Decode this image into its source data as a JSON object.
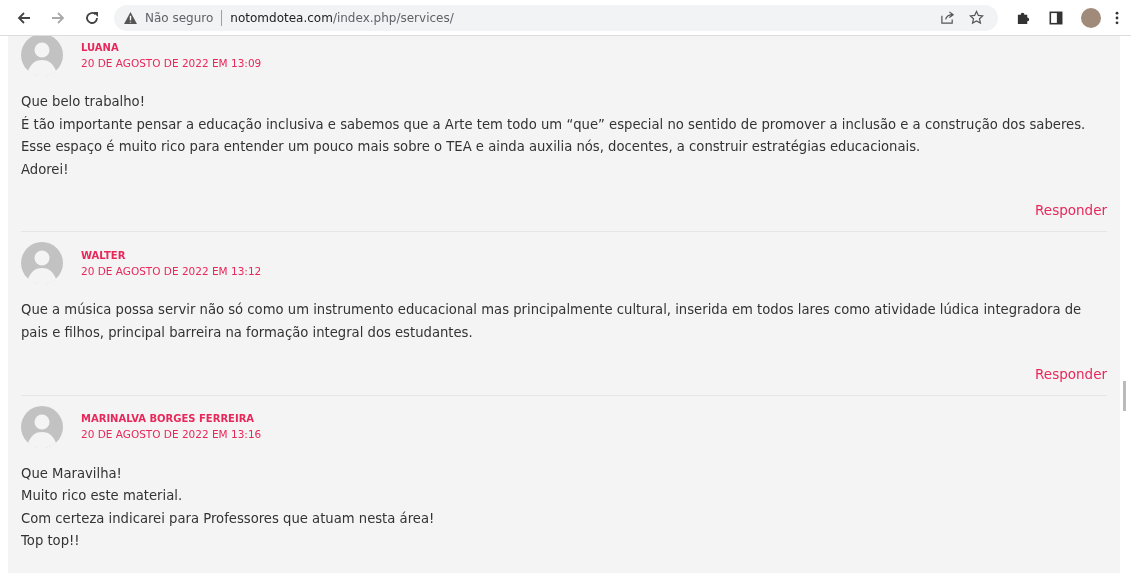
{
  "browser": {
    "security_label": "Não seguro",
    "url_host": "notomdotea.com",
    "url_path": "/index.php/services/"
  },
  "comments": [
    {
      "author": "LUANA",
      "date": "20 DE AGOSTO DE 2022 EM 13:09",
      "lines": [
        "Que belo trabalho!",
        "É tão importante pensar a educação inclusiva e sabemos que a Arte tem todo um “que” especial no sentido de promover a inclusão e a construção dos saberes.",
        "Esse espaço é muito rico para entender um pouco mais sobre o TEA e ainda auxilia nós, docentes, a construir estratégias educacionais.",
        "Adorei!"
      ],
      "reply": "Responder"
    },
    {
      "author": "WALTER",
      "date": "20 DE AGOSTO DE 2022 EM 13:12",
      "lines": [
        "Que a música possa servir não só como um instrumento educacional mas principalmente cultural, inserida em todos lares como atividade lúdica integradora de pais e filhos, principal barreira na formação integral dos estudantes."
      ],
      "reply": "Responder"
    },
    {
      "author": "MARINALVA BORGES FERREIRA",
      "date": "20 DE AGOSTO DE 2022 EM 13:16",
      "lines": [
        "Que Maravilha!",
        "Muito rico este material.",
        "Com certeza indicarei para Professores que atuam nesta área!",
        "Top top!!"
      ]
    }
  ]
}
